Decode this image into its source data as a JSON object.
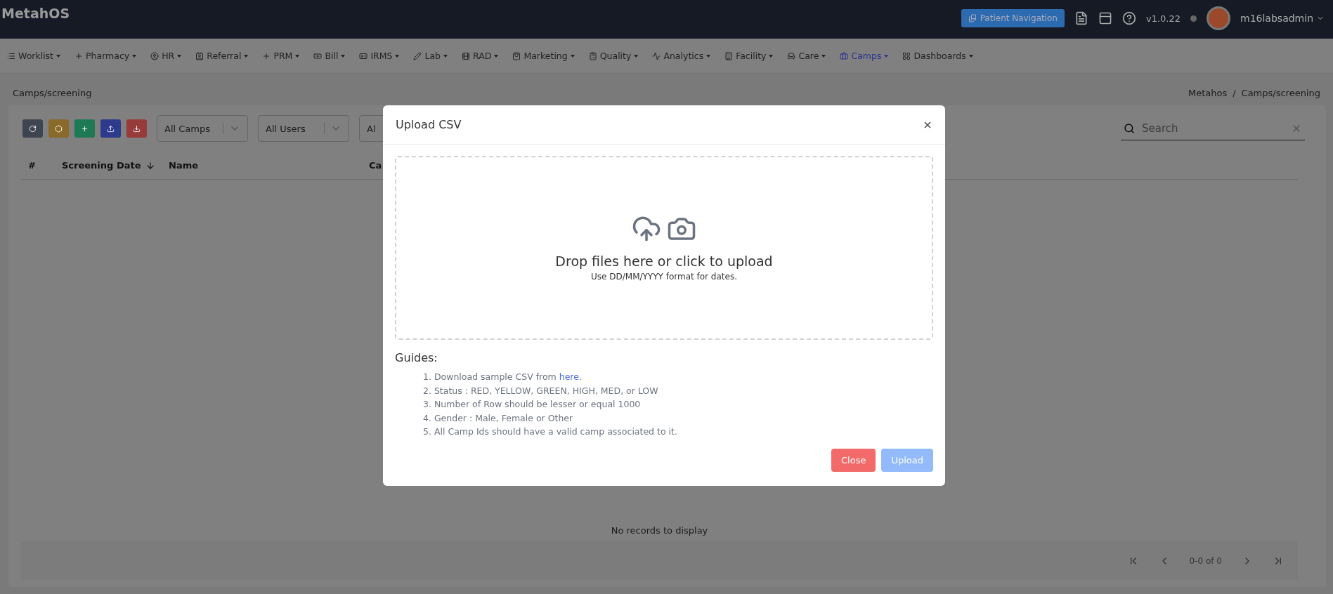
{
  "header": {
    "brand": "MetahOS",
    "patient_nav_button": "Patient Navigation",
    "version": "v1.0.22",
    "user": "m16labsadmin"
  },
  "nav": [
    {
      "label": "Worklist",
      "selected": false
    },
    {
      "label": "Pharmacy",
      "selected": false
    },
    {
      "label": "HR",
      "selected": false
    },
    {
      "label": "Referral",
      "selected": false
    },
    {
      "label": "PRM",
      "selected": false
    },
    {
      "label": "Bill",
      "selected": false
    },
    {
      "label": "IRMS",
      "selected": false
    },
    {
      "label": "Lab",
      "selected": false
    },
    {
      "label": "RAD",
      "selected": false
    },
    {
      "label": "Marketing",
      "selected": false
    },
    {
      "label": "Quality",
      "selected": false
    },
    {
      "label": "Analytics",
      "selected": false
    },
    {
      "label": "Facility",
      "selected": false
    },
    {
      "label": "Care",
      "selected": false
    },
    {
      "label": "Camps",
      "selected": true
    },
    {
      "label": "Dashboards",
      "selected": false
    }
  ],
  "page_title": "Camps/screening",
  "breadcrumb": [
    "Metahos",
    "Camps/screening"
  ],
  "breadcrumb_separator": "/",
  "toolbar": {
    "buttons": [
      {
        "kind": "refresh",
        "color": "#3f4451"
      },
      {
        "kind": "filter",
        "color": "#8a6a2a"
      },
      {
        "kind": "add",
        "color": "#1e7a55"
      },
      {
        "kind": "upload",
        "color": "#2e3a8c"
      },
      {
        "kind": "download",
        "color": "#963a3a"
      }
    ],
    "dropdowns": [
      "All Camps",
      "All Users",
      "Al"
    ],
    "search": {
      "placeholder": "Search"
    }
  },
  "table": {
    "columns": [
      "#",
      "Screening Date",
      "Name",
      "Ca"
    ],
    "empty_text": "No records to display",
    "pagination": "0-0 of 0"
  },
  "modal": {
    "title": "Upload CSV",
    "dropzone_title": "Drop files here or click to upload",
    "dropzone_hint": "Use DD/MM/YYYY format for dates.",
    "guides_title": "Guides:",
    "guides": [
      {
        "marker": "1.",
        "text": "Download sample CSV from ",
        "link": "here",
        "after": "."
      },
      {
        "marker": "2.",
        "text": "Status : RED, YELLOW, GREEN, HIGH, MED, or LOW"
      },
      {
        "marker": "3.",
        "text": "Number of Row should be lesser or equal 1000"
      },
      {
        "marker": "4.",
        "text": "Gender : Male, Female or Other"
      },
      {
        "marker": "5.",
        "text": "All Camp Ids should have a valid camp associated to it."
      }
    ],
    "buttons": [
      {
        "label": "Close",
        "kind": "danger",
        "disabled": false
      },
      {
        "label": "Upload",
        "kind": "primary",
        "disabled": true
      }
    ]
  }
}
